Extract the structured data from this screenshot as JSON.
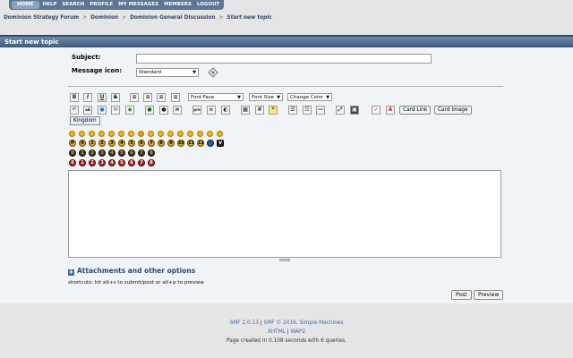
{
  "nav": {
    "items": [
      "HOME",
      "HELP",
      "SEARCH",
      "PROFILE",
      "MY MESSAGES",
      "MEMBERS",
      "LOGOUT"
    ]
  },
  "breadcrumb": {
    "items": [
      "Dominion Strategy Forum",
      "Dominion",
      "Dominion General Discussion"
    ],
    "current": "Start new topic",
    "separator": ">"
  },
  "panel": {
    "title": "Start new topic"
  },
  "form": {
    "subject_label": "Subject:",
    "subject_value": "",
    "icon_label": "Message icon:",
    "icon_value": "Standard"
  },
  "toolbar": {
    "format_buttons": [
      "B",
      "I",
      "U",
      "S"
    ],
    "font_face": "Font Face",
    "font_size": "Font Size",
    "change_color": "Change Color",
    "card_link": "Card Link",
    "card_image": "Card Image",
    "tooltip": "Kingdom"
  },
  "coins": {
    "gold_row": [
      "P",
      "0",
      "1",
      "2",
      "3",
      "4",
      "5",
      "6",
      "7",
      "8",
      "9",
      "10",
      "11",
      "12"
    ],
    "dark_row": [
      "0",
      "1",
      "2",
      "3",
      "4",
      "5",
      "6",
      "7",
      "8"
    ],
    "red_row": [
      "0",
      "1",
      "2",
      "3",
      "4",
      "5",
      "6",
      "7",
      "8"
    ]
  },
  "message": {
    "value": ""
  },
  "attachments": {
    "label": "Attachments and other options"
  },
  "shortcuts": "shortcuts: hit alt+s to submit/post or alt+p to preview",
  "buttons": {
    "post": "Post",
    "preview": "Preview"
  },
  "footer": {
    "smf_version": "SMF 2.0.13",
    "smf_copyright": "SMF © 2016, Simple Machines",
    "xhtml": "XHTML",
    "wap2": "WAP2",
    "separator": "|",
    "page_created": "Page created in 0.108 seconds with 6 queries."
  },
  "colors": {
    "header_bar": "#3c5a7b",
    "panel_bg": "#f0f4f7",
    "page_bg": "#e5e5e8",
    "link": "#4a6a9a"
  }
}
